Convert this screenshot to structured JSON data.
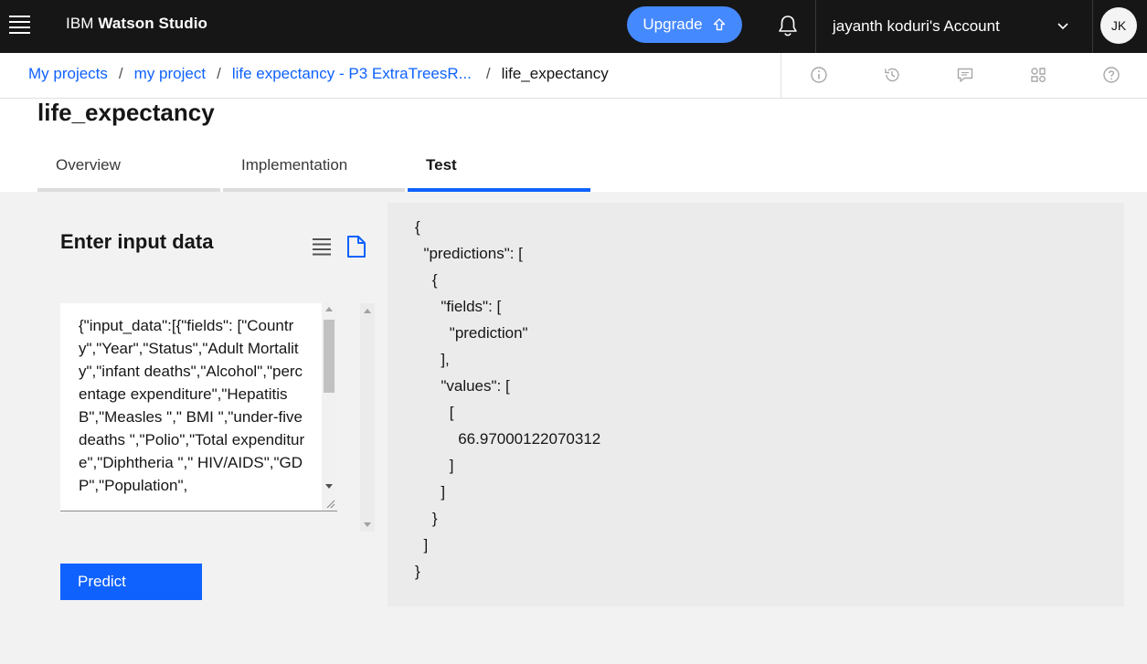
{
  "header": {
    "brand_prefix": "IBM",
    "brand_name": "Watson Studio",
    "upgrade_label": "Upgrade",
    "account_label": "jayanth koduri's Account",
    "avatar_initials": "JK"
  },
  "breadcrumb": {
    "items": [
      "My projects",
      "my project",
      "life expectancy - P3 ExtraTreesR..."
    ],
    "current": "life_expectancy",
    "separator": "/"
  },
  "page": {
    "title": "life_expectancy"
  },
  "tabs": [
    {
      "label": "Overview",
      "active": false
    },
    {
      "label": "Implementation",
      "active": false
    },
    {
      "label": "Test",
      "active": true
    }
  ],
  "input_panel": {
    "title": "Enter input data",
    "value": "{\"input_data\":[{\"fields\": [\"Country\",\"Year\",\"Status\",\"Adult Mortality\",\"infant deaths\",\"Alcohol\",\"percentage expenditure\",\"Hepatitis B\",\"Measles \",\" BMI \",\"under-five deaths \",\"Polio\",\"Total expenditure\",\"Diphtheria \",\" HIV/AIDS\",\"GDP\",\"Population\",",
    "predict_label": "Predict"
  },
  "output": {
    "json_text": "{\n  \"predictions\": [\n    {\n      \"fields\": [\n        \"prediction\"\n      ],\n      \"values\": [\n        [\n          66.97000122070312\n        ]\n      ]\n    }\n  ]\n}"
  },
  "icons": {
    "menu": "hamburger-icon",
    "upgrade": "arrow-up-icon",
    "notifications": "bell-icon",
    "account": "chevron-down-icon",
    "info": "info-icon",
    "history": "history-icon",
    "comments": "chat-icon",
    "assets": "assets-icon",
    "help": "help-icon",
    "list_view": "list-icon",
    "file_view": "file-icon"
  },
  "colors": {
    "accent": "#0f62fe",
    "upgrade_button": "#4589ff",
    "header_bg": "#161616"
  }
}
